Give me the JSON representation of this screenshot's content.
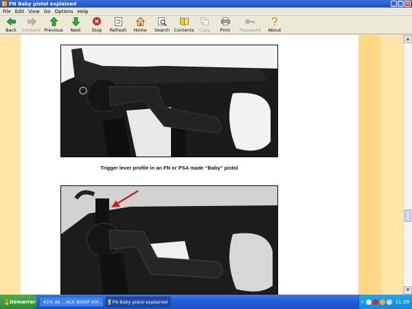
{
  "window": {
    "title": "FN Baby pistol explained",
    "min_glyph": "_",
    "max_glyph": "□",
    "close_glyph": "×"
  },
  "menu": [
    "File",
    "Edit",
    "View",
    "Go",
    "Options",
    "Help"
  ],
  "toolbar": [
    {
      "label": "Back",
      "icon": "back-arrow-icon",
      "enabled": true
    },
    {
      "label": "Forward",
      "icon": "forward-arrow-icon",
      "enabled": false
    },
    {
      "label": "Previous",
      "icon": "up-arrow-icon",
      "enabled": true
    },
    {
      "label": "Next",
      "icon": "down-arrow-icon",
      "enabled": true
    },
    {
      "label": "Stop",
      "icon": "stop-icon",
      "enabled": true
    },
    {
      "label": "Refresh",
      "icon": "refresh-icon",
      "enabled": true
    },
    {
      "label": "Home",
      "icon": "home-icon",
      "enabled": true
    },
    {
      "label": "Search",
      "icon": "search-icon",
      "enabled": true
    },
    {
      "label": "Contents",
      "icon": "contents-icon",
      "enabled": true
    },
    {
      "label": "Copy",
      "icon": "copy-icon",
      "enabled": false
    },
    {
      "label": "Print",
      "icon": "print-icon",
      "enabled": true
    },
    {
      "label": "Password",
      "icon": "key-icon",
      "enabled": false
    },
    {
      "label": "About",
      "icon": "about-icon",
      "enabled": true
    }
  ],
  "page": {
    "caption": "Trigger lever profile in an FN or PSA made “Baby” pistol"
  },
  "colors": {
    "page_background": "#FFE6A8",
    "band": "#FFD785",
    "red_arrow": "#d01818"
  },
  "scrollbar": {
    "position_fraction": 0.72
  },
  "taskbar": {
    "start_label": "Démarrer",
    "tasks": [
      {
        "label": "42% de ...ACK BDRIP XVI...",
        "active": false
      },
      {
        "label": "FN Baby pistol explained",
        "active": true
      }
    ],
    "tray_chevron": "«",
    "clock": "11:59"
  }
}
